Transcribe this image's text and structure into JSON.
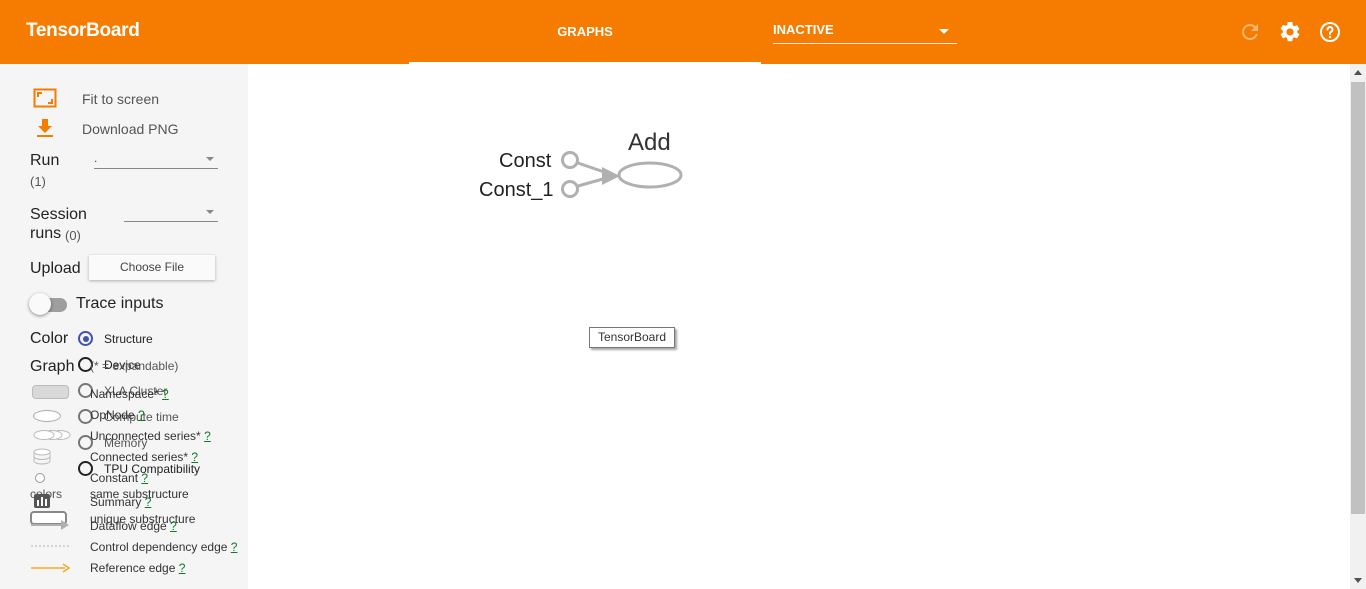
{
  "header": {
    "brand": "TensorBoard",
    "tab_graphs": "GRAPHS",
    "inactive_select": "INACTIVE",
    "icons": [
      "refresh-icon",
      "gear-icon",
      "help-icon"
    ],
    "color": "#f57c00"
  },
  "sidebar": {
    "fit_to_screen": "Fit to screen",
    "download_png": "Download PNG",
    "run_label": "Run",
    "run_count": "(1)",
    "run_value": ".",
    "session_label_1": "Session",
    "session_label_2": "runs",
    "session_count": "(0)",
    "upload_label": "Upload",
    "choose_file": "Choose File",
    "trace_inputs": "Trace inputs",
    "color_label": "Color",
    "color_options": [
      "Structure",
      "Device",
      "XLA Cluster",
      "Compute time",
      "Memory",
      "TPU Compatibility"
    ],
    "color_selected": "Structure",
    "graph_label": "Graph",
    "expandable_note": "(* = expandable)",
    "legend": {
      "namespace": "Namespace*",
      "opnode": "OpNode",
      "unconnected": "Unconnected series*",
      "connected": "Connected series*",
      "constant": "Constant",
      "summary": "Summary",
      "dataflow": "Dataflow edge",
      "control": "Control dependency edge",
      "reference": "Reference edge",
      "help_mark": "?"
    },
    "colors_label": "colors",
    "same_substructure": "same substructure",
    "unique_substructure": "unique substructure"
  },
  "graph": {
    "nodes": [
      "Const",
      "Const_1",
      "Add"
    ]
  },
  "tooltip": "TensorBoard"
}
